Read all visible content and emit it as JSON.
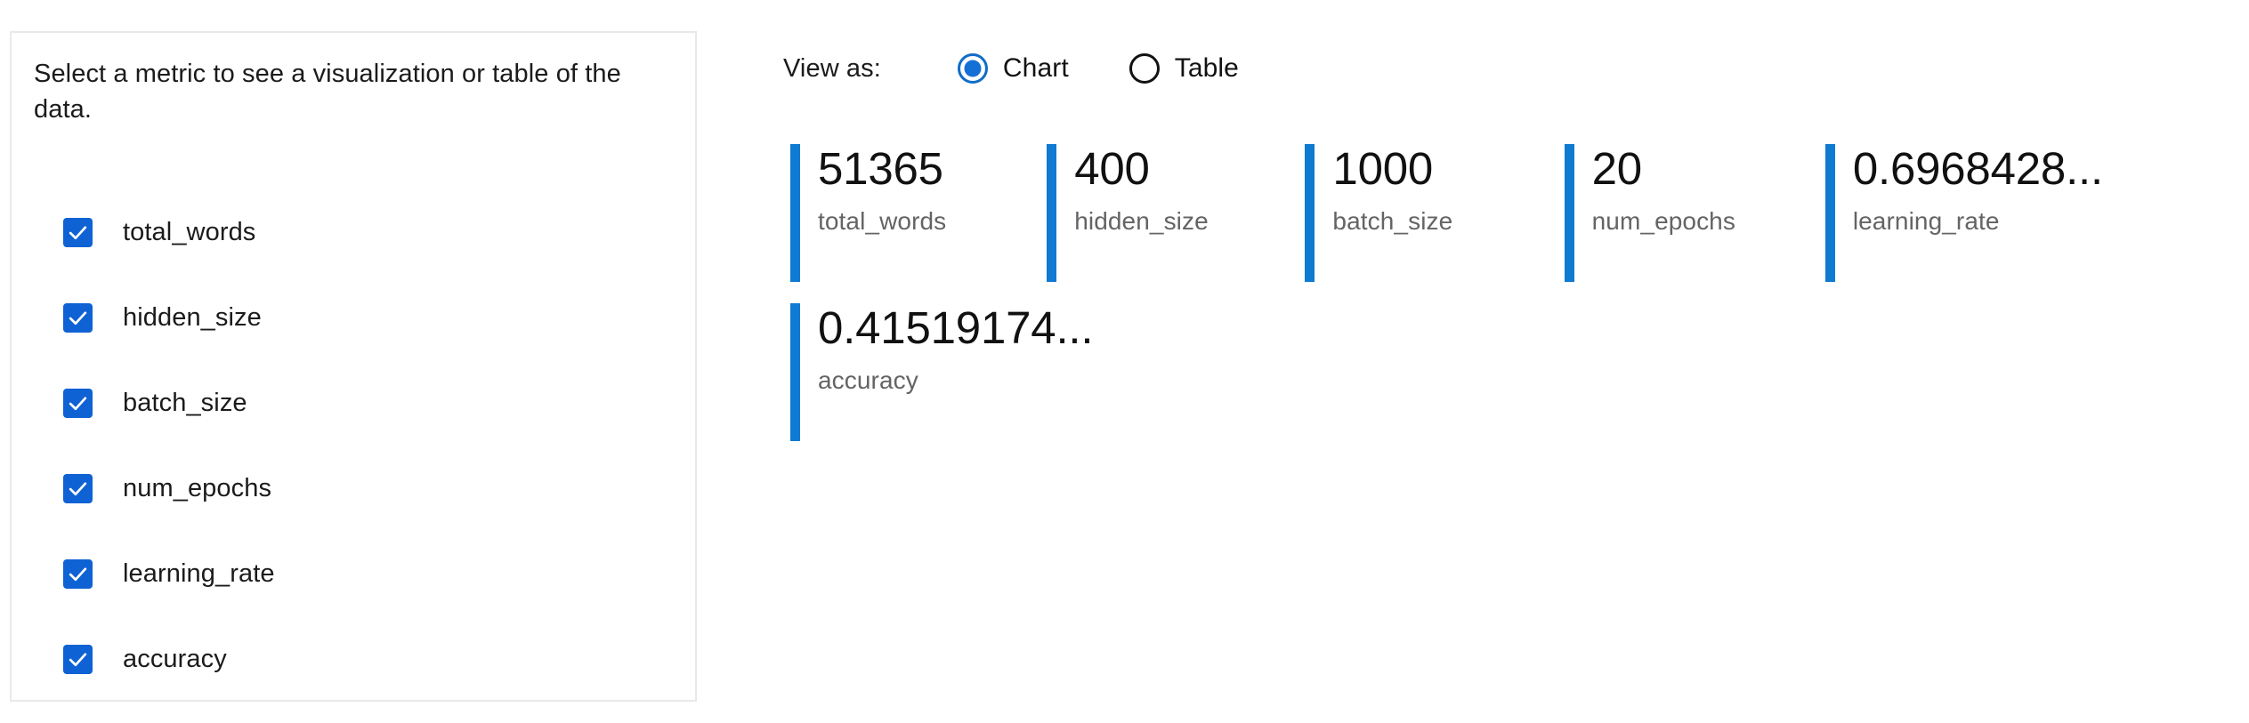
{
  "panel": {
    "instruction": "Select a metric to see a visualization or table of the data.",
    "metrics": [
      {
        "label": "total_words",
        "checked": true
      },
      {
        "label": "hidden_size",
        "checked": true
      },
      {
        "label": "batch_size",
        "checked": true
      },
      {
        "label": "num_epochs",
        "checked": true
      },
      {
        "label": "learning_rate",
        "checked": true
      },
      {
        "label": "accuracy",
        "checked": true
      }
    ]
  },
  "view_toggle": {
    "label": "View as:",
    "options": [
      {
        "label": "Chart",
        "selected": true
      },
      {
        "label": "Table",
        "selected": false
      }
    ],
    "selected": "Chart"
  },
  "colors": {
    "accent_blue": "#0f7ad1",
    "checkbox_blue": "#0f62d4",
    "radio_blue": "#1570d6",
    "panel_border": "#e9e9e9",
    "value_text": "#111111",
    "label_text": "#646464"
  },
  "chart_data": {
    "type": "table",
    "title": "",
    "xlabel": "",
    "ylabel": "",
    "categories": [
      "total_words",
      "hidden_size",
      "batch_size",
      "num_epochs",
      "learning_rate",
      "accuracy"
    ],
    "values": [
      51365,
      400,
      1000,
      20,
      0.6968428,
      0.41519174
    ],
    "display_values": [
      "51365",
      "400",
      "1000",
      "20",
      "0.6968428...",
      "0.41519174..."
    ],
    "cards": [
      {
        "value": "51365",
        "label": "total_words"
      },
      {
        "value": "400",
        "label": "hidden_size"
      },
      {
        "value": "1000",
        "label": "batch_size"
      },
      {
        "value": "20",
        "label": "num_epochs"
      },
      {
        "value": "0.6968428...",
        "label": "learning_rate"
      },
      {
        "value": "0.41519174...",
        "label": "accuracy"
      }
    ]
  }
}
